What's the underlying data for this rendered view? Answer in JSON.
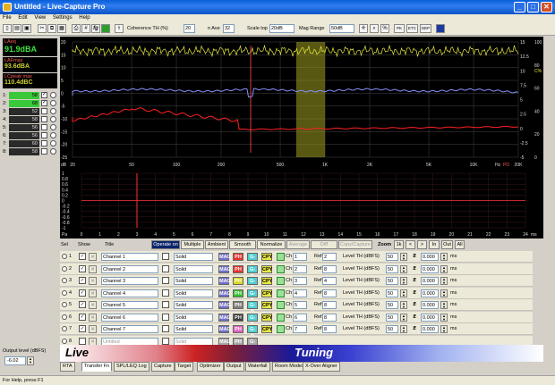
{
  "window": {
    "title": "Untitled - Live-Capture Pro",
    "buttons": [
      "_",
      "□",
      "✕"
    ]
  },
  "menu": [
    "File",
    "Edit",
    "View",
    "Settings",
    "Help"
  ],
  "toolbar": {
    "coherence_label": "Coherence TH (%)",
    "coherence_value": "20",
    "nave_label": "n Ave",
    "nave_value": "32",
    "scale_top_label": "Scale top",
    "scale_top_value": "20dB",
    "mag_range_label": "Mag Range",
    "mag_range_value": "50dB",
    "icon_fg": "fg",
    "toggles": [
      "PK",
      "ETC",
      "DEP"
    ]
  },
  "meters": [
    {
      "label": "LAeq",
      "value": "91.9dBA"
    },
    {
      "label": "LAFmax",
      "value": "93.6dBA"
    },
    {
      "label": "LCpeak max",
      "value": "110.4dBC"
    }
  ],
  "level_rows": [
    {
      "n": "1:",
      "value": "58",
      "on": true,
      "checked": true
    },
    {
      "n": "2:",
      "value": "68",
      "on": true,
      "checked": true
    },
    {
      "n": "3:",
      "value": "52",
      "on": false,
      "checked": false
    },
    {
      "n": "4:",
      "value": "58",
      "on": false,
      "checked": false
    },
    {
      "n": "5:",
      "value": "56",
      "on": false,
      "checked": false
    },
    {
      "n": "6:",
      "value": "56",
      "on": false,
      "checked": false
    },
    {
      "n": "7:",
      "value": "60",
      "on": false,
      "checked": false
    },
    {
      "n": "8:",
      "value": "58",
      "on": false,
      "checked": false
    }
  ],
  "plot": {
    "x_ticks": [
      "20",
      "50",
      "100",
      "200",
      "500",
      "1K",
      "2K",
      "5K",
      "10K",
      "20K"
    ],
    "x_unit": "Hz",
    "x_unit2": "PD",
    "left_ticks": [
      "20",
      "15",
      "10",
      "5",
      "0",
      "-5",
      "-10",
      "-15",
      "-20",
      "-25"
    ],
    "right_ticks": [
      "15",
      "12.5",
      "10",
      "7.5",
      "5",
      "2.5",
      "0",
      "-2.5",
      "-5"
    ],
    "far_right_ticks": [
      "100",
      "",
      "80",
      "",
      "60",
      "",
      "40",
      "",
      "20",
      "",
      "0"
    ],
    "right_unit": "C%",
    "left_unit": "dB"
  },
  "plot2": {
    "x_ticks": [
      "0",
      "1",
      "2",
      "3",
      "4",
      "5",
      "6",
      "7",
      "8",
      "9",
      "10",
      "11",
      "12",
      "13",
      "14",
      "15",
      "16",
      "17",
      "18",
      "19",
      "20",
      "21",
      "22",
      "23",
      "24"
    ],
    "y_ticks": [
      "1",
      "0.8",
      "0.6",
      "0.4",
      "0.2",
      "0",
      "-0.2",
      "-0.4",
      "-0.6",
      "-0.8",
      "-1"
    ],
    "x_unit": "ms",
    "y_unit": "Pa"
  },
  "controls": {
    "col_sel": "Sel",
    "col_show": "Show",
    "col_title": "Title",
    "buttons": [
      "Operate on",
      "Multiple",
      "Ambient",
      "Smooth",
      "Normalize",
      "Average",
      "Diff",
      "Copy/Capture"
    ],
    "zoom": "Zoom",
    "zoom_btns": [
      "1k",
      "<",
      ">",
      "In",
      "Out",
      "All"
    ]
  },
  "channels": [
    {
      "sel": "1",
      "title": "Channel 1",
      "style": "Solid",
      "color": "#e83030",
      "ch": "1",
      "ref": "2",
      "th": "50",
      "delay": "0.000"
    },
    {
      "sel": "2",
      "title": "Channel 2",
      "style": "Solid",
      "color": "#e83030",
      "ch": "2",
      "ref": "8",
      "th": "50",
      "delay": "0.000"
    },
    {
      "sel": "3",
      "title": "Channel 3",
      "style": "Solid",
      "color": "#d8d820",
      "ch": "3",
      "ref": "4",
      "th": "50",
      "delay": "0.000"
    },
    {
      "sel": "4",
      "title": "Channel 4",
      "style": "Solid",
      "color": "#30c030",
      "ch": "4",
      "ref": "8",
      "th": "50",
      "delay": "0.000"
    },
    {
      "sel": "5",
      "title": "Channel 5",
      "style": "Solid",
      "color": "#808080",
      "ch": "5",
      "ref": "8",
      "th": "50",
      "delay": "0.000"
    },
    {
      "sel": "6",
      "title": "Channel 6",
      "style": "Solid",
      "color": "#404040",
      "ch": "6",
      "ref": "8",
      "th": "50",
      "delay": "0.000"
    },
    {
      "sel": "7",
      "title": "Channel 7",
      "style": "Solid",
      "color": "#e060c0",
      "ch": "7",
      "ref": "8",
      "th": "50",
      "delay": "0.000"
    },
    {
      "sel": "8",
      "title": "Untitled",
      "style": "Solid",
      "color": "#999999",
      "ch": "",
      "ref": "",
      "th": "",
      "delay": ""
    }
  ],
  "row_labels": {
    "mag": "MAG",
    "ph": "PH",
    "gd": "G-D",
    "ch": "Ch",
    "ref": "Ref",
    "level_th": "Level TH (dBFS)",
    "ms": "ms",
    "cpy": "CPY"
  },
  "output_level": {
    "label": "Output level (dBFS)",
    "value": "-6.02"
  },
  "live": {
    "left": "Live",
    "right": "Tuning"
  },
  "tabs": [
    "RTA",
    "Transfer Fn",
    "SPL/LEQ Log",
    "Capture",
    "Target",
    "Optimizer",
    "Output",
    "Waterfall",
    "Room Modes",
    "X-Over Aligner"
  ],
  "active_tab": "Transfer Fn",
  "status": "For Help, press F1",
  "colors": {
    "coherence": "#e8e840",
    "magnitude": "#8890ff",
    "phase": "#ff2020",
    "highlight": "#a0a020"
  }
}
